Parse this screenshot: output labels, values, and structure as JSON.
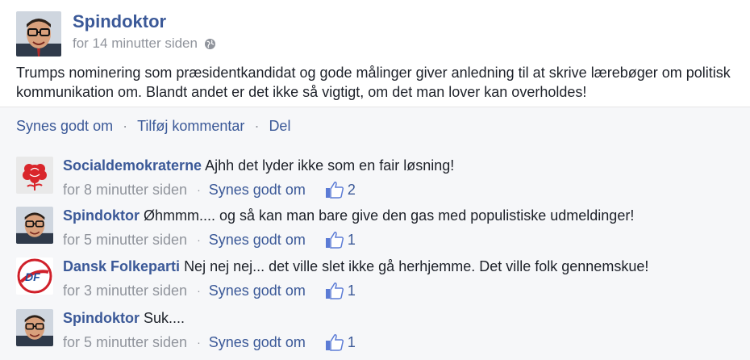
{
  "post": {
    "author": "Spindoktor",
    "timestamp": "for 14 minutter siden",
    "text": "Trumps nominering som præsidentkandidat og gode målinger giver anledning til at skrive lærebøger om politisk kommunikation om. Blandt andet er det ikke så vigtigt, om det man lover kan overholdes!",
    "actions": {
      "like": "Synes godt om",
      "comment": "Tilføj kommentar",
      "share": "Del",
      "separator": "·"
    }
  },
  "comments": [
    {
      "author": "Socialdemokraterne",
      "text": "Ajhh det lyder ikke som en fair løsning!",
      "timestamp": "for 8 minutter siden",
      "like_label": "Synes godt om",
      "likes": "2",
      "avatar": "rose-logo-icon"
    },
    {
      "author": "Spindoktor",
      "text": "Øhmmm.... og så kan man bare give den gas med populistiske udmeldinger!",
      "timestamp": "for 5 minutter siden",
      "like_label": "Synes godt om",
      "likes": "1",
      "avatar": "spindoktor-avatar"
    },
    {
      "author": "Dansk Folkeparti",
      "text": "Nej nej nej... det ville slet ikke gå herhjemme. Det ville folk gennemskue!",
      "timestamp": "for 3 minutter siden",
      "like_label": "Synes godt om",
      "likes": "1",
      "avatar": "df-logo-icon"
    },
    {
      "author": "Spindoktor",
      "text": "Suk....",
      "timestamp": "for 5 minutter siden",
      "like_label": "Synes godt om",
      "likes": "1",
      "avatar": "spindoktor-avatar"
    }
  ],
  "colors": {
    "link": "#3b5998",
    "meta": "#90949c",
    "comment_bg": "#f6f7f9",
    "rose": "#d9262b",
    "df_red": "#d0202a",
    "df_blue": "#1f4e9c"
  }
}
